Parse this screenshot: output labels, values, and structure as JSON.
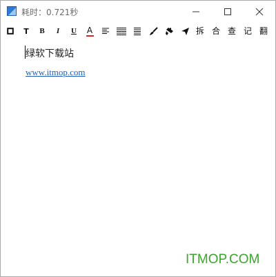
{
  "window": {
    "title": "耗时：0.721秒"
  },
  "toolbar": {
    "items": [
      {
        "name": "square-toolbar-icon",
        "label": ""
      },
      {
        "name": "text-style-T-button",
        "label": "T"
      },
      {
        "name": "bold-button",
        "label": "B"
      },
      {
        "name": "italic-button",
        "label": "I"
      },
      {
        "name": "underline-button",
        "label": "U"
      },
      {
        "name": "font-color-button",
        "label": "A"
      },
      {
        "name": "align-left-icon",
        "label": ""
      },
      {
        "name": "align-justify-icon",
        "label": ""
      },
      {
        "name": "align-right-icon",
        "label": ""
      },
      {
        "name": "brush-icon",
        "label": ""
      },
      {
        "name": "format-painter-icon",
        "label": ""
      },
      {
        "name": "send-icon",
        "label": ""
      },
      {
        "name": "split-button",
        "label": "拆"
      },
      {
        "name": "merge-button",
        "label": "合"
      },
      {
        "name": "search-button",
        "label": "查"
      },
      {
        "name": "record-button",
        "label": "记"
      },
      {
        "name": "translate-button",
        "label": "翻"
      }
    ]
  },
  "editor": {
    "line1": "绿软下载站",
    "link": "www.itmop.com"
  },
  "watermark": "ITMOP.COM",
  "colors": {
    "link": "#1f5fb8",
    "watermark": "#3aa52c",
    "font_color_bar": "#e02020"
  }
}
